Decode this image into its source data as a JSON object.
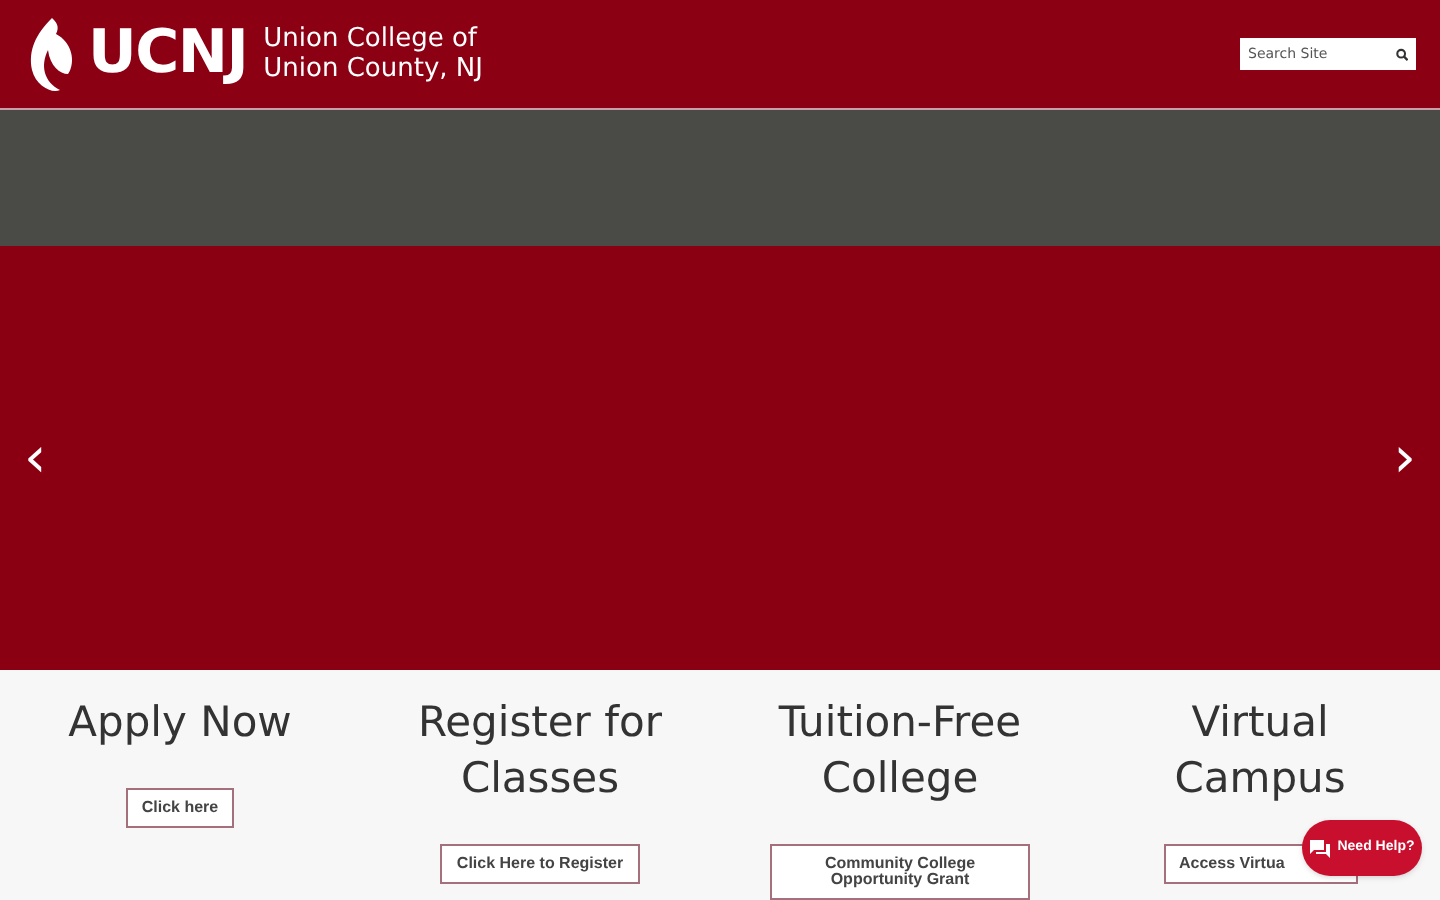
{
  "header": {
    "logo_mark": "UCNJ",
    "logo_lines": [
      "Union College of",
      "Union County, NJ"
    ],
    "search": {
      "placeholder": "Search Site"
    }
  },
  "carousel": {
    "prev": "‹",
    "next": "›"
  },
  "features": [
    {
      "title": "Apply Now",
      "button": "Click here"
    },
    {
      "title": "Register for Classes",
      "button": "Click Here to Register"
    },
    {
      "title": "Tuition-Free College",
      "button": "Community College Opportunity Grant"
    },
    {
      "title": "Virtual Campus",
      "button": "Access Virtua"
    }
  ],
  "chat": {
    "label": "Need Help?"
  }
}
